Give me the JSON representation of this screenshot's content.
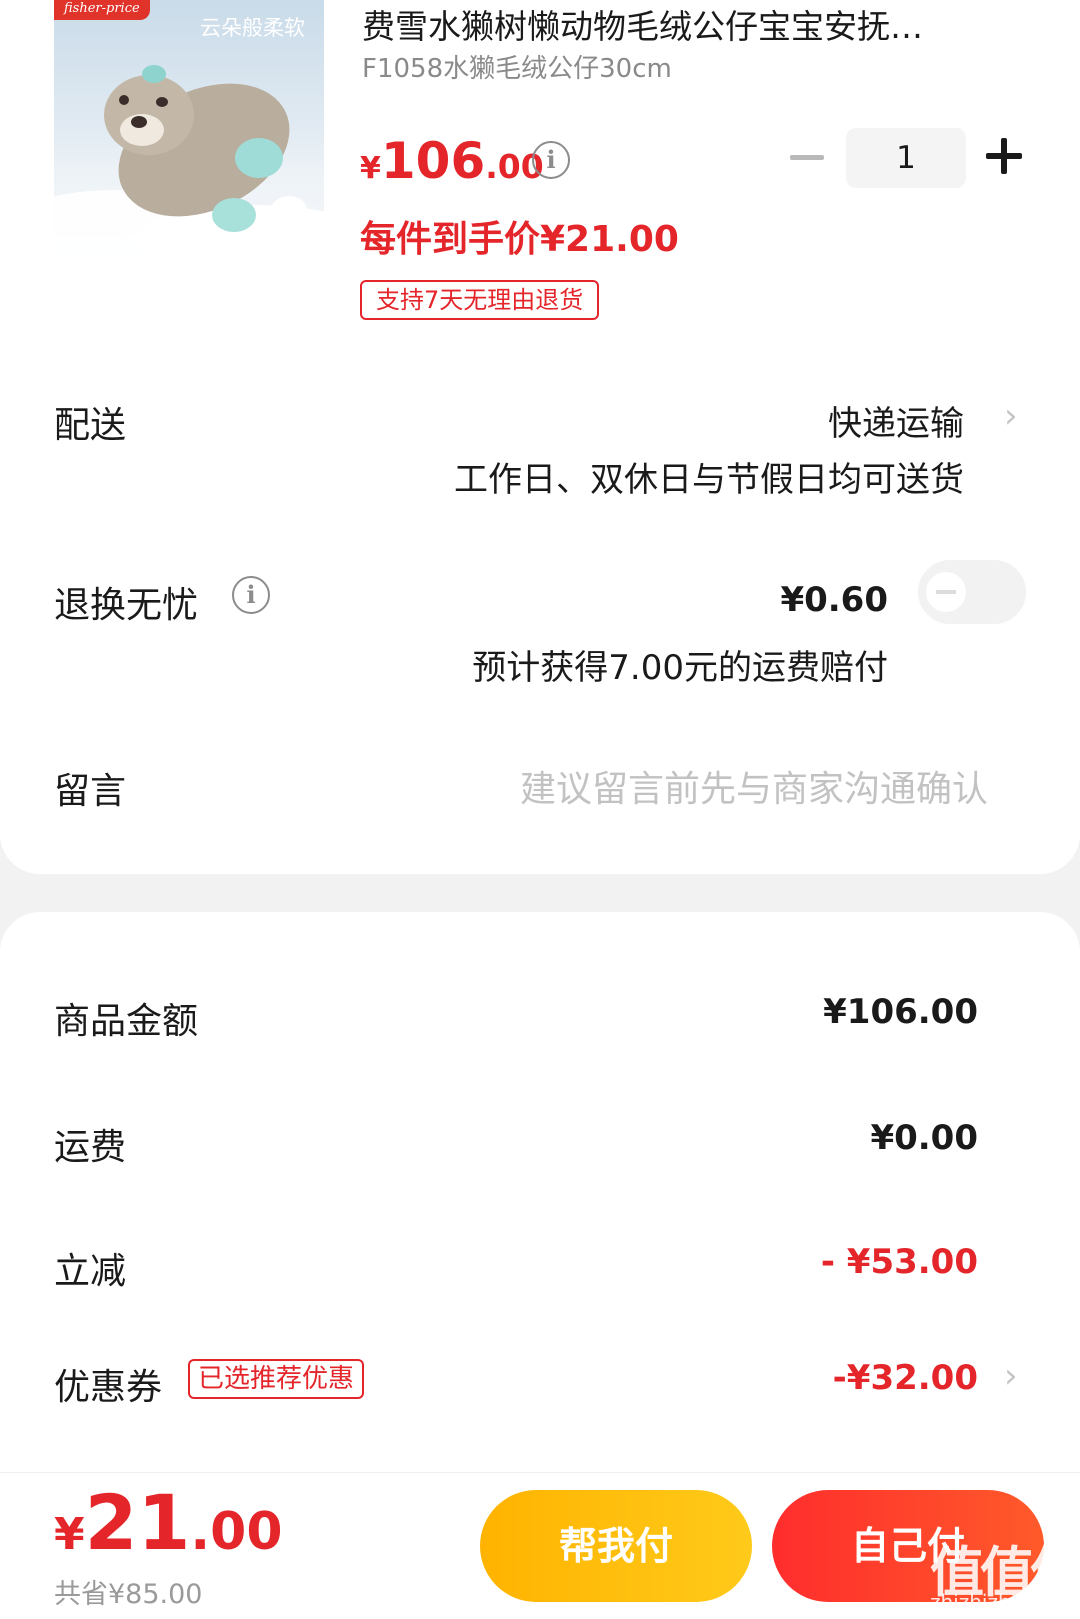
{
  "product": {
    "brand_badge": "fisher-price",
    "image_caption": "云朵般柔软",
    "title": "费雪水獭树懒动物毛绒公仔宝宝安抚…",
    "spec": "F1058水獭毛绒公仔30cm",
    "price_symbol": "¥",
    "price_int": "106",
    "price_dec": ".00",
    "quantity": "1",
    "unit_price": "每件到手价¥21.00",
    "return_tag": "支持7天无理由退货"
  },
  "delivery": {
    "label": "配送",
    "method": "快递运输",
    "note": "工作日、双休日与节假日均可送货"
  },
  "return_insurance": {
    "label": "退换无忧",
    "price": "¥0.60",
    "note": "预计获得7.00元的运费赔付",
    "enabled": false
  },
  "message": {
    "label": "留言",
    "placeholder": "建议留言前先与商家沟通确认"
  },
  "summary": {
    "goods_label": "商品金额",
    "goods_value": "¥106.00",
    "shipping_label": "运费",
    "shipping_value": "¥0.00",
    "discount_label": "立减",
    "discount_value": "- ¥53.00",
    "coupon_label": "优惠券",
    "coupon_tag": "已选推荐优惠",
    "coupon_value": "-¥32.00"
  },
  "footer": {
    "total_symbol": "¥",
    "total_int": "21",
    "total_dec": ".00",
    "saved": "共省¥85.00",
    "help_pay_label": "帮我付",
    "self_pay_label": "自己付"
  },
  "watermark": {
    "text": "值值值",
    "url": "zhizhizhi.com"
  },
  "colors": {
    "accent_red": "#e4262b",
    "help_btn": "#ffb300",
    "self_btn": "#ff2d2d"
  }
}
